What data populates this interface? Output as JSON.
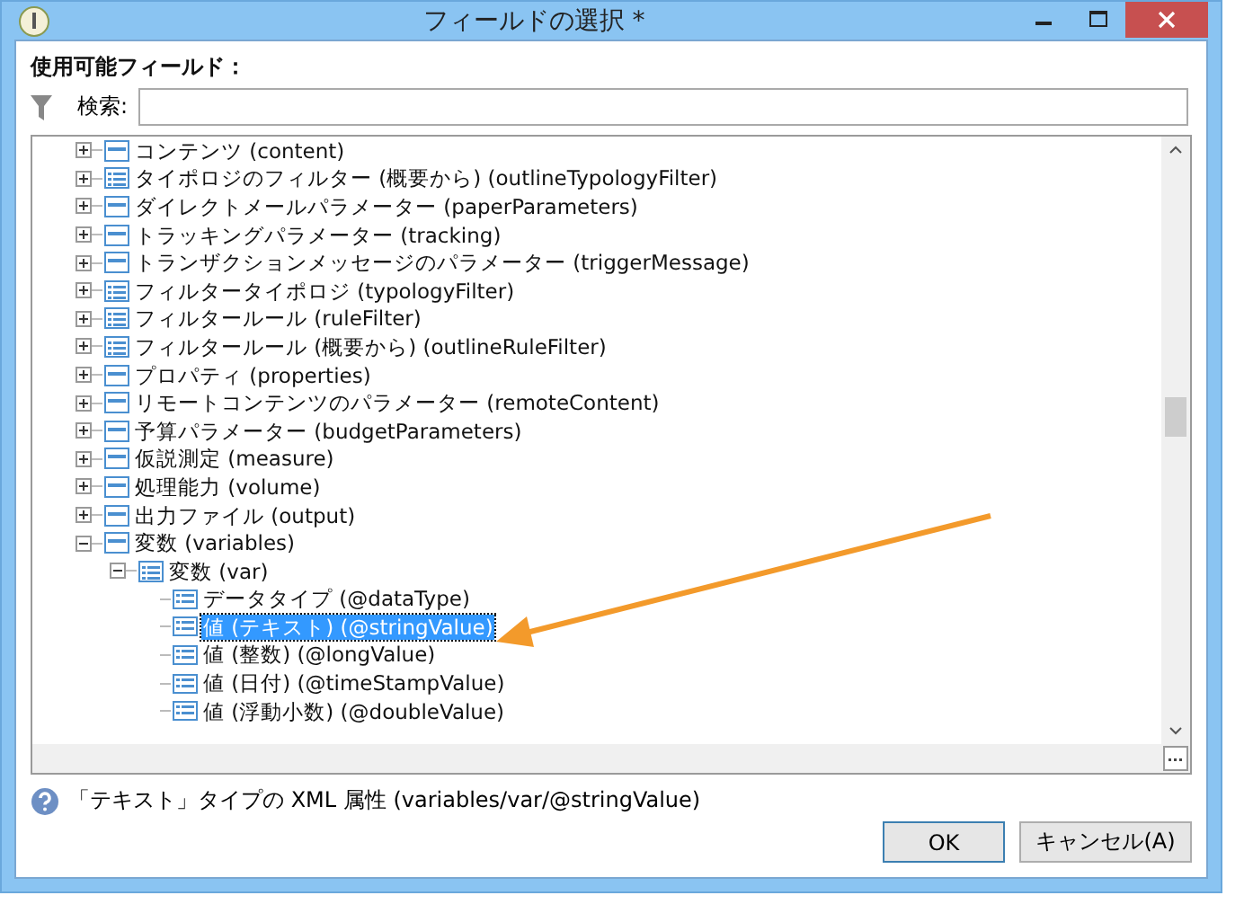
{
  "window": {
    "title": "フィールドの選択 *"
  },
  "available_label": "使用可能フィールド：",
  "search": {
    "label": "検索:"
  },
  "tree": [
    {
      "label": "コンテンツ (content)",
      "kind": "group",
      "expanded": false,
      "selected": false
    },
    {
      "label": "タイポロジのフィルター (概要から) (outlineTypologyFilter)",
      "kind": "list",
      "expanded": false,
      "selected": false
    },
    {
      "label": "ダイレクトメールパラメーター (paperParameters)",
      "kind": "group",
      "expanded": false,
      "selected": false
    },
    {
      "label": "トラッキングパラメーター (tracking)",
      "kind": "group",
      "expanded": false,
      "selected": false
    },
    {
      "label": "トランザクションメッセージのパラメーター (triggerMessage)",
      "kind": "group",
      "expanded": false,
      "selected": false
    },
    {
      "label": "フィルタータイポロジ (typologyFilter)",
      "kind": "list",
      "expanded": false,
      "selected": false
    },
    {
      "label": "フィルタールール (ruleFilter)",
      "kind": "list",
      "expanded": false,
      "selected": false
    },
    {
      "label": "フィルタールール (概要から) (outlineRuleFilter)",
      "kind": "list",
      "expanded": false,
      "selected": false
    },
    {
      "label": "プロパティ (properties)",
      "kind": "group",
      "expanded": false,
      "selected": false
    },
    {
      "label": "リモートコンテンツのパラメーター (remoteContent)",
      "kind": "group",
      "expanded": false,
      "selected": false
    },
    {
      "label": "予算パラメーター (budgetParameters)",
      "kind": "group",
      "expanded": false,
      "selected": false
    },
    {
      "label": "仮説測定 (measure)",
      "kind": "group",
      "expanded": false,
      "selected": false
    },
    {
      "label": "処理能力 (volume)",
      "kind": "group",
      "expanded": false,
      "selected": false
    },
    {
      "label": "出力ファイル (output)",
      "kind": "group",
      "expanded": false,
      "selected": false
    },
    {
      "label": "変数 (variables)",
      "kind": "group",
      "expanded": true,
      "selected": false,
      "children": [
        {
          "label": "変数 (var)",
          "kind": "list",
          "expanded": true,
          "selected": false,
          "children": [
            {
              "label": "データタイプ (@dataType)",
              "kind": "attribute",
              "selected": false
            },
            {
              "label": "値 (テキスト) (@stringValue)",
              "kind": "attribute",
              "selected": true
            },
            {
              "label": "値 (整数) (@longValue)",
              "kind": "attribute",
              "selected": false
            },
            {
              "label": "値 (日付) (@timeStampValue)",
              "kind": "attribute",
              "selected": false
            },
            {
              "label": "値 (浮動小数) (@doubleValue)",
              "kind": "attribute",
              "selected": false
            }
          ]
        }
      ]
    }
  ],
  "description": "「テキスト」タイプの XML 属性 (variables/var/@stringValue)",
  "buttons": [
    {
      "label": "OK",
      "default": true
    },
    {
      "label": "キャンセル(A)",
      "default": false
    }
  ]
}
